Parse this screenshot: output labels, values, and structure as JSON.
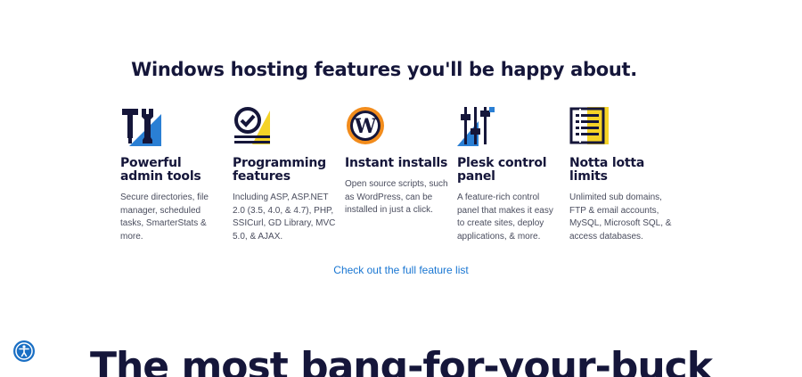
{
  "section": {
    "title": "Windows hosting features you'll be happy about."
  },
  "features": [
    {
      "icon": "tools-icon",
      "title": "Powerful admin tools",
      "description": "Secure directories, file manager, scheduled tasks, SmarterStats & more."
    },
    {
      "icon": "code-check-icon",
      "title": "Programming features",
      "description": "Including ASP, ASP.NET 2.0 (3.5, 4.0, & 4.7), PHP, SSICurl, GD Library, MVC 5.0, & AJAX."
    },
    {
      "icon": "wordpress-icon",
      "title": "Instant installs",
      "description": "Open source scripts, such as WordPress, can be installed in just a click."
    },
    {
      "icon": "sliders-icon",
      "title": "Plesk control panel",
      "description": "A feature-rich control panel that makes it easy to create sites, deploy applications, & more."
    },
    {
      "icon": "list-icon",
      "title": "Notta lotta limits",
      "description": "Unlimited sub domains, FTP & email accounts, MySQL, Microsoft SQL, & access databases."
    }
  ],
  "link": {
    "label": "Check out the full feature list"
  },
  "next_section": {
    "title": "The most bang-for-your-buck"
  },
  "colors": {
    "navy": "#15163a",
    "blue": "#2a7fd4",
    "yellow": "#f5d327",
    "orange": "#f28c1c",
    "link": "#1976d2",
    "accessibility": "#1a6fc4"
  },
  "accessibility": {
    "icon": "accessibility-icon"
  }
}
